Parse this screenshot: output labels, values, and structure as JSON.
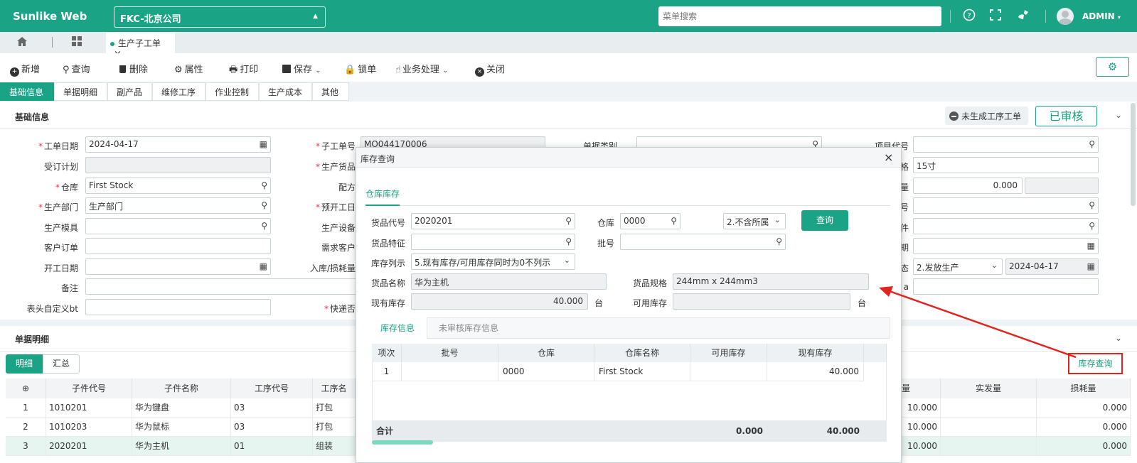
{
  "app": {
    "title": "Sunlike Web",
    "company": "FKC-北京公司",
    "menu_search_placeholder": "菜单搜索",
    "user": "ADMIN"
  },
  "tabs": {
    "open_doc": "生产子工单",
    "close_glyph": "×"
  },
  "toolbar": {
    "new": "新增",
    "query": "查询",
    "delete": "删除",
    "properties": "属性",
    "print": "打印",
    "save": "保存",
    "lock": "锁单",
    "business": "业务处理",
    "close": "关闭"
  },
  "section_tabs": [
    "基础信息",
    "单据明细",
    "副产品",
    "维修工序",
    "作业控制",
    "生产成本",
    "其他"
  ],
  "basic": {
    "title": "基础信息",
    "not_generated_label": "未生成工序工单",
    "approved_label": "已审核",
    "col1": [
      {
        "label": "工单日期",
        "required": true,
        "value": "2024-04-17"
      },
      {
        "label": "受订计划",
        "required": false,
        "value": ""
      },
      {
        "label": "仓库",
        "required": true,
        "value": "First Stock"
      },
      {
        "label": "生产部门",
        "required": true,
        "value": "生产部门"
      },
      {
        "label": "生产模具",
        "required": false,
        "value": ""
      },
      {
        "label": "客户订单",
        "required": false,
        "value": ""
      },
      {
        "label": "开工日期",
        "required": false,
        "value": ""
      },
      {
        "label": "备注",
        "required": false,
        "value": ""
      },
      {
        "label": "表头自定义bt",
        "required": false,
        "value": ""
      }
    ],
    "col2": [
      {
        "label": "子工单号",
        "required": true,
        "value": "MO044170006"
      },
      {
        "label": "生产货品",
        "required": true
      },
      {
        "label": "配方",
        "required": false
      },
      {
        "label": "预开工日",
        "required": true
      },
      {
        "label": "生产设备",
        "required": false
      },
      {
        "label": "需求客户",
        "required": false
      },
      {
        "label": "入库/损耗量",
        "required": false
      },
      {
        "label": "快递否",
        "required": true
      }
    ],
    "col3_label": "单据类别",
    "col4": [
      {
        "label": "项目代号",
        "value": ""
      },
      {
        "label": "格",
        "value": "15寸"
      },
      {
        "label": "量",
        "value": "0.000"
      },
      {
        "label": "号",
        "value": ""
      },
      {
        "label": "件",
        "value": ""
      },
      {
        "label": "期",
        "value": ""
      },
      {
        "label": "态",
        "value": "2.发放生产",
        "date": "2024-04-17"
      },
      {
        "label": "a",
        "value": ""
      }
    ]
  },
  "detail": {
    "title": "单据明细",
    "tab_detail": "明细",
    "tab_summary": "汇总",
    "stock_query": "库存查询",
    "columns": [
      "子件代号",
      "子件名称",
      "工序代号",
      "工序名"
    ],
    "right_columns": [
      "量",
      "实发量",
      "损耗量"
    ],
    "rows": [
      {
        "no": "1",
        "code": "1010201",
        "name": "华为键盘",
        "op": "03",
        "opname": "打包",
        "qty": "10.000",
        "loss": "0.000"
      },
      {
        "no": "2",
        "code": "1010203",
        "name": "华为鼠标",
        "op": "03",
        "opname": "打包",
        "qty": "10.000",
        "loss": "0.000"
      },
      {
        "no": "3",
        "code": "2020201",
        "name": "华为主机",
        "op": "01",
        "opname": "组装",
        "qty": "10.000",
        "loss": "0.000"
      }
    ]
  },
  "modal": {
    "title": "库存查询",
    "close_glyph": "×",
    "tab": "仓库库存",
    "item_code_label": "货品代号",
    "item_code": "2020201",
    "warehouse_label": "仓库",
    "warehouse": "0000",
    "scope": "2.不含所属",
    "query_btn": "查询",
    "feature_label": "货品特征",
    "feature": "",
    "batch_label": "批号",
    "batch": "",
    "list_label": "库存列示",
    "list_value": "5.现有库存/可用库存同时为0不列示",
    "name_label": "货品名称",
    "name": "华为主机",
    "spec_label": "货品规格",
    "spec": "244mm x 244mm3",
    "onhand_label": "现有库存",
    "onhand": "40.000",
    "unit": "台",
    "avail_label": "可用库存",
    "avail": "",
    "info_tab1": "库存信息",
    "info_tab2": "未审核库存信息",
    "grid_headers": [
      "项次",
      "批号",
      "仓库",
      "仓库名称",
      "可用库存",
      "现有库存"
    ],
    "grid_row": {
      "no": "1",
      "batch": "",
      "wh": "0000",
      "whname": "First Stock",
      "avail": "",
      "onhand": "40.000"
    },
    "total_label": "合计",
    "total_avail": "0.000",
    "total_onhand": "40.000"
  },
  "colors": {
    "accent": "#1aa385",
    "annotation": "#e0251f"
  }
}
